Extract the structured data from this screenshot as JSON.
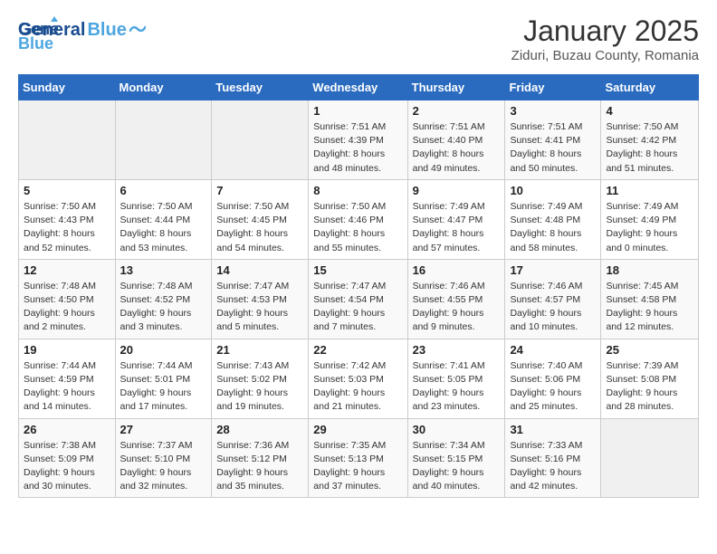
{
  "header": {
    "logo_line1": "General",
    "logo_line2": "Blue",
    "month_title": "January 2025",
    "location": "Ziduri, Buzau County, Romania"
  },
  "days_of_week": [
    "Sunday",
    "Monday",
    "Tuesday",
    "Wednesday",
    "Thursday",
    "Friday",
    "Saturday"
  ],
  "weeks": [
    [
      {
        "num": "",
        "info": ""
      },
      {
        "num": "",
        "info": ""
      },
      {
        "num": "",
        "info": ""
      },
      {
        "num": "1",
        "info": "Sunrise: 7:51 AM\nSunset: 4:39 PM\nDaylight: 8 hours and 48 minutes."
      },
      {
        "num": "2",
        "info": "Sunrise: 7:51 AM\nSunset: 4:40 PM\nDaylight: 8 hours and 49 minutes."
      },
      {
        "num": "3",
        "info": "Sunrise: 7:51 AM\nSunset: 4:41 PM\nDaylight: 8 hours and 50 minutes."
      },
      {
        "num": "4",
        "info": "Sunrise: 7:50 AM\nSunset: 4:42 PM\nDaylight: 8 hours and 51 minutes."
      }
    ],
    [
      {
        "num": "5",
        "info": "Sunrise: 7:50 AM\nSunset: 4:43 PM\nDaylight: 8 hours and 52 minutes."
      },
      {
        "num": "6",
        "info": "Sunrise: 7:50 AM\nSunset: 4:44 PM\nDaylight: 8 hours and 53 minutes."
      },
      {
        "num": "7",
        "info": "Sunrise: 7:50 AM\nSunset: 4:45 PM\nDaylight: 8 hours and 54 minutes."
      },
      {
        "num": "8",
        "info": "Sunrise: 7:50 AM\nSunset: 4:46 PM\nDaylight: 8 hours and 55 minutes."
      },
      {
        "num": "9",
        "info": "Sunrise: 7:49 AM\nSunset: 4:47 PM\nDaylight: 8 hours and 57 minutes."
      },
      {
        "num": "10",
        "info": "Sunrise: 7:49 AM\nSunset: 4:48 PM\nDaylight: 8 hours and 58 minutes."
      },
      {
        "num": "11",
        "info": "Sunrise: 7:49 AM\nSunset: 4:49 PM\nDaylight: 9 hours and 0 minutes."
      }
    ],
    [
      {
        "num": "12",
        "info": "Sunrise: 7:48 AM\nSunset: 4:50 PM\nDaylight: 9 hours and 2 minutes."
      },
      {
        "num": "13",
        "info": "Sunrise: 7:48 AM\nSunset: 4:52 PM\nDaylight: 9 hours and 3 minutes."
      },
      {
        "num": "14",
        "info": "Sunrise: 7:47 AM\nSunset: 4:53 PM\nDaylight: 9 hours and 5 minutes."
      },
      {
        "num": "15",
        "info": "Sunrise: 7:47 AM\nSunset: 4:54 PM\nDaylight: 9 hours and 7 minutes."
      },
      {
        "num": "16",
        "info": "Sunrise: 7:46 AM\nSunset: 4:55 PM\nDaylight: 9 hours and 9 minutes."
      },
      {
        "num": "17",
        "info": "Sunrise: 7:46 AM\nSunset: 4:57 PM\nDaylight: 9 hours and 10 minutes."
      },
      {
        "num": "18",
        "info": "Sunrise: 7:45 AM\nSunset: 4:58 PM\nDaylight: 9 hours and 12 minutes."
      }
    ],
    [
      {
        "num": "19",
        "info": "Sunrise: 7:44 AM\nSunset: 4:59 PM\nDaylight: 9 hours and 14 minutes."
      },
      {
        "num": "20",
        "info": "Sunrise: 7:44 AM\nSunset: 5:01 PM\nDaylight: 9 hours and 17 minutes."
      },
      {
        "num": "21",
        "info": "Sunrise: 7:43 AM\nSunset: 5:02 PM\nDaylight: 9 hours and 19 minutes."
      },
      {
        "num": "22",
        "info": "Sunrise: 7:42 AM\nSunset: 5:03 PM\nDaylight: 9 hours and 21 minutes."
      },
      {
        "num": "23",
        "info": "Sunrise: 7:41 AM\nSunset: 5:05 PM\nDaylight: 9 hours and 23 minutes."
      },
      {
        "num": "24",
        "info": "Sunrise: 7:40 AM\nSunset: 5:06 PM\nDaylight: 9 hours and 25 minutes."
      },
      {
        "num": "25",
        "info": "Sunrise: 7:39 AM\nSunset: 5:08 PM\nDaylight: 9 hours and 28 minutes."
      }
    ],
    [
      {
        "num": "26",
        "info": "Sunrise: 7:38 AM\nSunset: 5:09 PM\nDaylight: 9 hours and 30 minutes."
      },
      {
        "num": "27",
        "info": "Sunrise: 7:37 AM\nSunset: 5:10 PM\nDaylight: 9 hours and 32 minutes."
      },
      {
        "num": "28",
        "info": "Sunrise: 7:36 AM\nSunset: 5:12 PM\nDaylight: 9 hours and 35 minutes."
      },
      {
        "num": "29",
        "info": "Sunrise: 7:35 AM\nSunset: 5:13 PM\nDaylight: 9 hours and 37 minutes."
      },
      {
        "num": "30",
        "info": "Sunrise: 7:34 AM\nSunset: 5:15 PM\nDaylight: 9 hours and 40 minutes."
      },
      {
        "num": "31",
        "info": "Sunrise: 7:33 AM\nSunset: 5:16 PM\nDaylight: 9 hours and 42 minutes."
      },
      {
        "num": "",
        "info": ""
      }
    ]
  ]
}
